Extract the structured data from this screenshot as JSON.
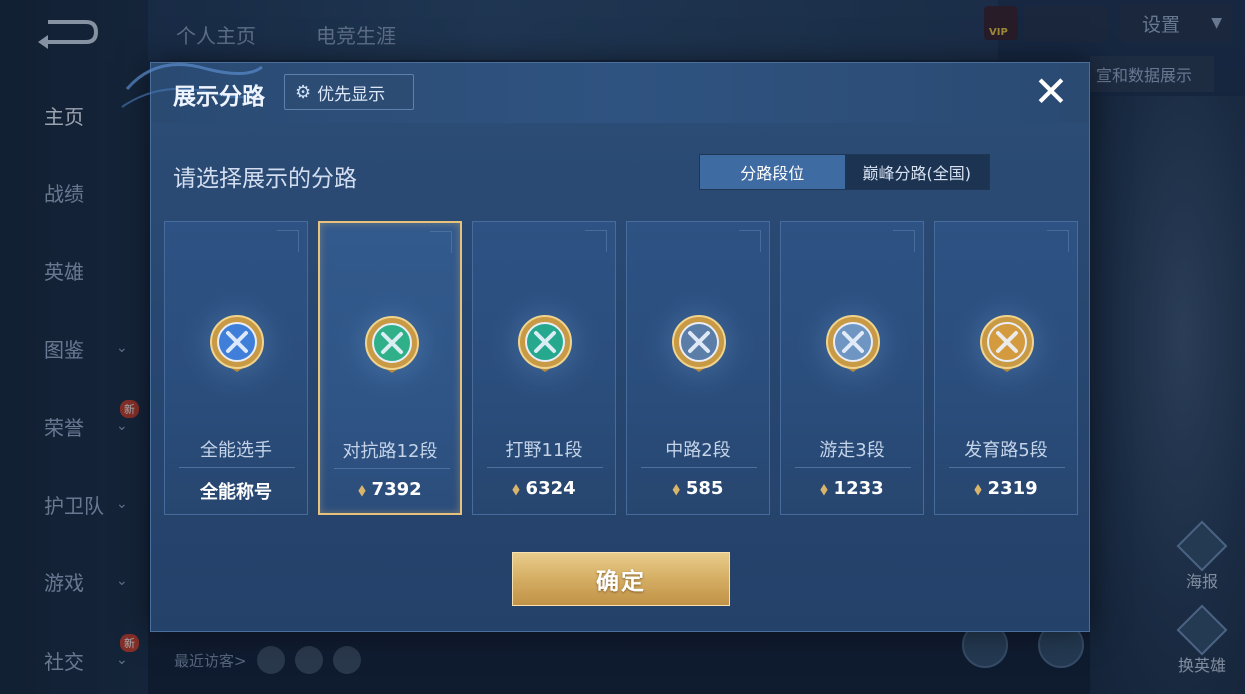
{
  "background": {
    "nav": [
      {
        "label": "主页",
        "active": true,
        "chevron": false,
        "badge": ""
      },
      {
        "label": "战绩",
        "active": false,
        "chevron": false,
        "badge": ""
      },
      {
        "label": "英雄",
        "active": false,
        "chevron": false,
        "badge": ""
      },
      {
        "label": "图鉴",
        "active": false,
        "chevron": true,
        "badge": ""
      },
      {
        "label": "荣誉",
        "active": false,
        "chevron": true,
        "badge": "新"
      },
      {
        "label": "护卫队",
        "active": false,
        "chevron": true,
        "badge": ""
      },
      {
        "label": "游戏",
        "active": false,
        "chevron": true,
        "badge": ""
      },
      {
        "label": "社交",
        "active": false,
        "chevron": true,
        "badge": "新"
      }
    ],
    "top_tabs": [
      "个人主页",
      "电竞生涯"
    ],
    "settings_label": "设置",
    "vip_label": "VIP",
    "right_chip_label": "宣和数据展示",
    "side_buttons": [
      "海报",
      "换英雄"
    ],
    "recent_visitors_label": "最近访客>"
  },
  "modal": {
    "title": "展示分路",
    "priority_label": "优先显示",
    "close_icon": "close-icon",
    "subtitle": "请选择展示的分路",
    "segments": [
      {
        "label": "分路段位",
        "active": true
      },
      {
        "label": "巅峰分路(全国)",
        "active": false
      }
    ],
    "cards": [
      {
        "name": "全能选手",
        "stat": "全能称号",
        "show_medal": false,
        "selected": false,
        "emblem": "all-round-emblem-icon",
        "color": "#3f7fd9"
      },
      {
        "name": "对抗路12段",
        "stat": "7392",
        "show_medal": true,
        "selected": true,
        "emblem": "clash-lane-emblem-icon",
        "color": "#2fb089"
      },
      {
        "name": "打野11段",
        "stat": "6324",
        "show_medal": true,
        "selected": false,
        "emblem": "jungle-emblem-icon",
        "color": "#26a88f"
      },
      {
        "name": "中路2段",
        "stat": "585",
        "show_medal": true,
        "selected": false,
        "emblem": "mid-lane-emblem-icon",
        "color": "#5a7ea8"
      },
      {
        "name": "游走3段",
        "stat": "1233",
        "show_medal": true,
        "selected": false,
        "emblem": "roam-emblem-icon",
        "color": "#6f95c2"
      },
      {
        "name": "发育路5段",
        "stat": "2319",
        "show_medal": true,
        "selected": false,
        "emblem": "farm-lane-emblem-icon",
        "color": "#d39a3e"
      }
    ],
    "confirm_label": "确定"
  },
  "colors": {
    "accent_gold": "#d5ae63",
    "selected_border": "#e6c27a",
    "segment_active": "#3f6ba3"
  }
}
